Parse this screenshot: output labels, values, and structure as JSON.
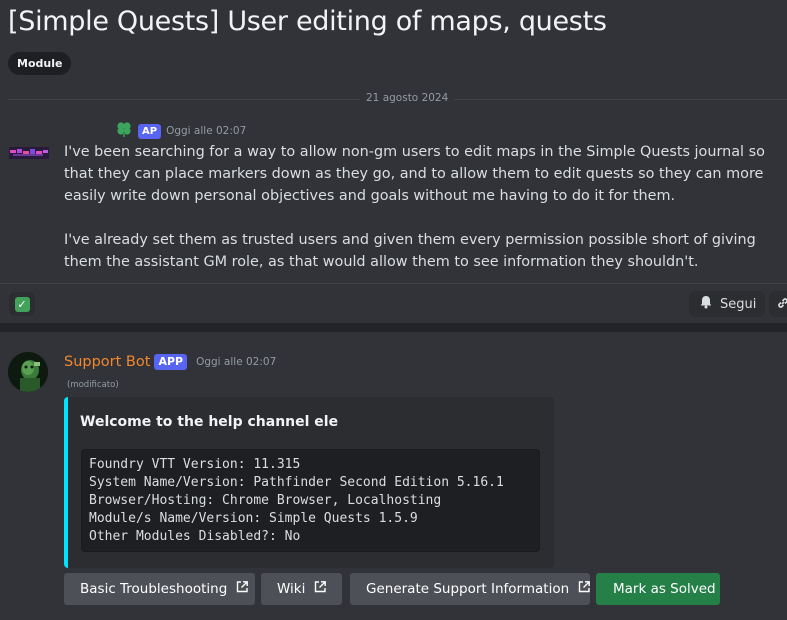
{
  "thread": {
    "title": "[Simple Quests] User editing of maps, quests",
    "tag": "Module",
    "date_divider": "21 agosto 2024"
  },
  "message1": {
    "badge": "AP",
    "timestamp": "Oggi alle 02:07",
    "paragraph1": "I've been searching for a way to allow non-gm users to edit maps in the Simple Quests journal so that they can place markers down as they go, and to allow them to edit quests so they can more easily write down personal objectives and goals without me having to do it for them.",
    "paragraph2": "I've already set them as trusted users and given them every permission possible short of giving them the assistant GM role, as that would allow them to see information they shouldn't.",
    "reaction_icon": "check-mark-icon",
    "follow_label": "Segui"
  },
  "message2": {
    "author": "Support Bot",
    "badge": "APP",
    "timestamp": "Oggi alle 02:07",
    "edited": "(modificato)",
    "embed_title": "Welcome to the help channel ele",
    "embed_color": "#00e4ff",
    "code_lines": [
      "Foundry VTT Version: 11.315",
      "System Name/Version: Pathfinder Second Edition 5.16.1",
      "Browser/Hosting: Chrome Browser, Localhosting",
      "Module/s Name/Version: Simple Quests 1.5.9",
      "Other Modules Disabled?: No"
    ],
    "buttons": {
      "basic_troubleshooting": "Basic Troubleshooting",
      "wiki": "Wiki",
      "generate_support": "Generate Support Information",
      "mark_solved": "Mark as Solved"
    }
  },
  "colors": {
    "background": "#313338",
    "author_orange": "#f0882d",
    "badge_blurple": "#5865f2",
    "solved_green": "#248046"
  }
}
